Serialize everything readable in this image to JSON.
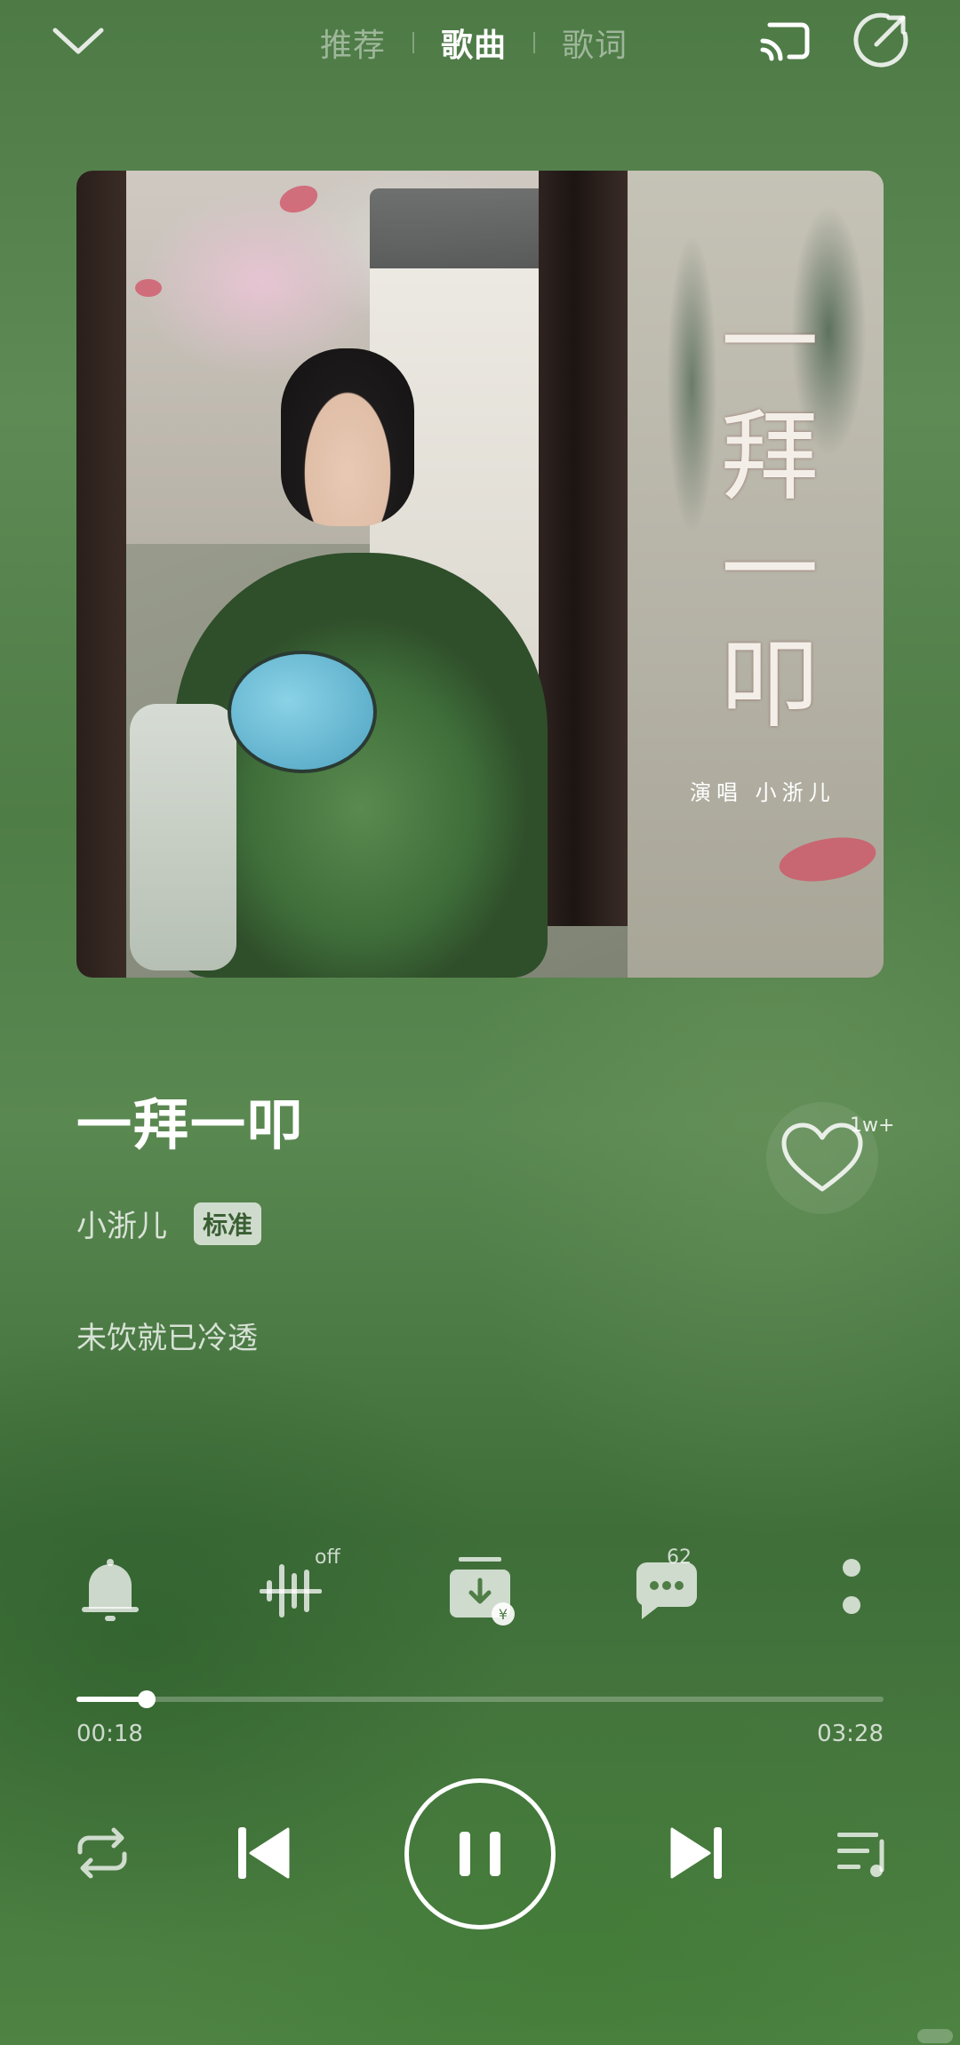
{
  "header": {
    "tabs": [
      {
        "label": "推荐",
        "active": false
      },
      {
        "label": "歌曲",
        "active": true
      },
      {
        "label": "歌词",
        "active": false
      }
    ],
    "icons": [
      "chevron-down-icon",
      "cast-icon",
      "share-icon"
    ]
  },
  "cover": {
    "title_lines": [
      "一",
      "拜",
      "一",
      "叩"
    ],
    "singer_line": "演唱 小浙儿"
  },
  "song": {
    "title": "一拜一叩",
    "artist": "小浙儿",
    "quality": "标准",
    "current_lyric": "未饮就已冷透",
    "like_count": "1w+"
  },
  "actions": {
    "sound_effect_state": "off",
    "comment_count": "62",
    "icons": [
      "bell-icon",
      "sound-effect-icon",
      "download-icon",
      "comment-icon",
      "more-icon"
    ]
  },
  "player": {
    "current_time": "00:18",
    "total_time": "03:28",
    "progress": 0.0865,
    "state": "playing"
  },
  "colors": {
    "background": "#4f7d46",
    "accent": "#ffffff"
  }
}
